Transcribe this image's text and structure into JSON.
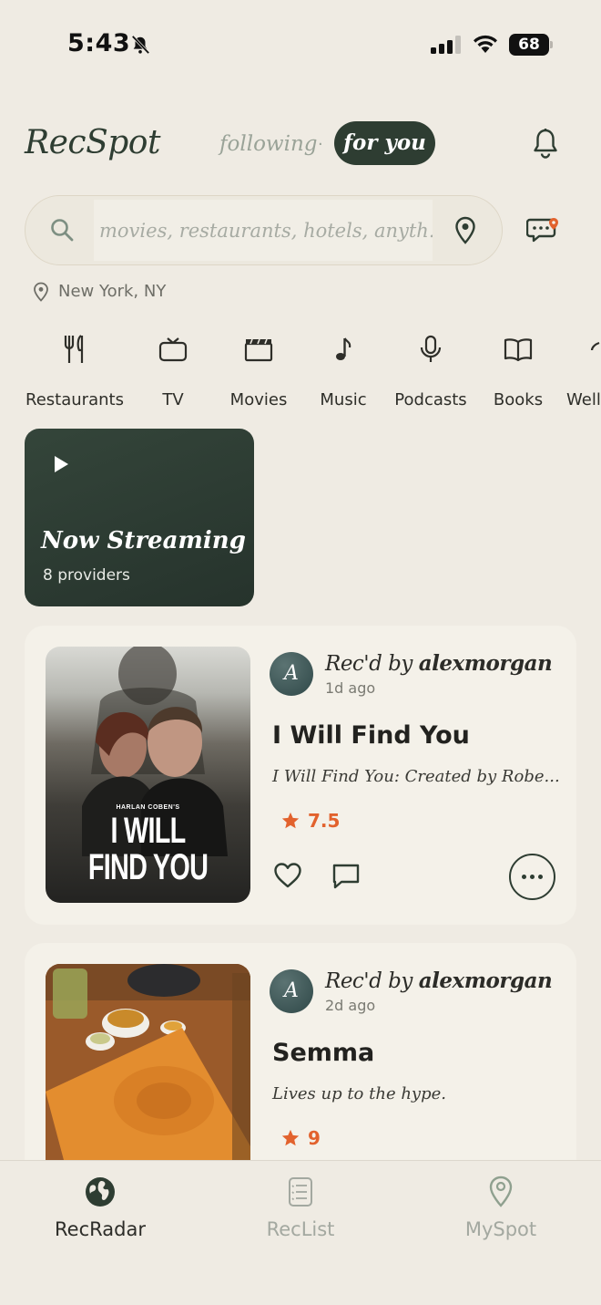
{
  "status_bar": {
    "time": "5:43",
    "battery": "68",
    "icons": [
      "bell-slash-icon",
      "signal-icon",
      "wifi-icon",
      "battery-icon"
    ]
  },
  "header": {
    "logo": "RecSpot",
    "tabs": [
      {
        "label": "following",
        "active": false
      },
      {
        "label": "for you",
        "active": true
      }
    ],
    "separator": "·",
    "notification_icon": "bell-icon"
  },
  "search": {
    "placeholder": "movies, restaurants, hotels, anyth...",
    "location": "New York, NY"
  },
  "categories": [
    {
      "label": "Restaurants",
      "icon": "fork-knife-icon"
    },
    {
      "label": "TV",
      "icon": "tv-icon"
    },
    {
      "label": "Movies",
      "icon": "clapperboard-icon"
    },
    {
      "label": "Music",
      "icon": "music-note-icon"
    },
    {
      "label": "Podcasts",
      "icon": "microphone-icon"
    },
    {
      "label": "Books",
      "icon": "book-icon"
    },
    {
      "label": "Well",
      "icon": "wellness-icon"
    }
  ],
  "now_streaming": {
    "title": "Now Streaming",
    "subtitle": "8 providers"
  },
  "feed": [
    {
      "avatar_letter": "A",
      "recd_prefix": "Rec'd by",
      "user": "alexmorgan",
      "time_ago": "1d ago",
      "title": "I Will Find You",
      "description": "I Will Find You: Created by Robe...",
      "rating": "7.5",
      "poster_small": "HARLAN COBEN'S",
      "poster_line1": "I WILL",
      "poster_line2": "FIND YOU"
    },
    {
      "avatar_letter": "A",
      "recd_prefix": "Rec'd by",
      "user": "alexmorgan",
      "time_ago": "2d ago",
      "title": "Semma",
      "description": "Lives up to the hype.",
      "rating": "9"
    }
  ],
  "bottom_nav": [
    {
      "label": "RecRadar",
      "icon": "globe-icon",
      "active": true
    },
    {
      "label": "RecList",
      "icon": "checklist-icon",
      "active": false
    },
    {
      "label": "MySpot",
      "icon": "location-pin-icon",
      "active": false
    }
  ],
  "colors": {
    "background": "#efebe3",
    "primary_green": "#2e3d32",
    "accent_orange": "#e2622d",
    "card": "#f4f1e9"
  }
}
